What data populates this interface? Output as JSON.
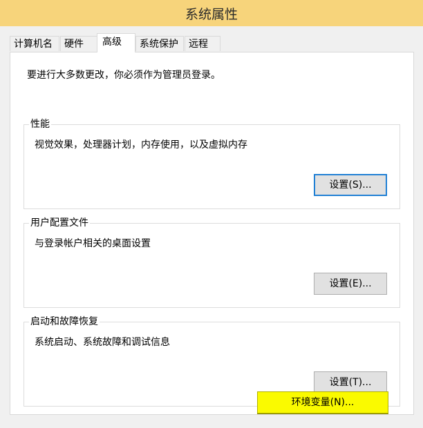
{
  "window": {
    "title": "系统属性"
  },
  "tabs": [
    {
      "label": "计算机名"
    },
    {
      "label": "硬件"
    },
    {
      "label": "高级"
    },
    {
      "label": "系统保护"
    },
    {
      "label": "远程"
    }
  ],
  "active_tab": "高级",
  "panel": {
    "notice": "要进行大多数更改，你必须作为管理员登录。",
    "groups": [
      {
        "title": "性能",
        "description": "视觉效果，处理器计划，内存使用，以及虚拟内存",
        "button": "设置(S)..."
      },
      {
        "title": "用户配置文件",
        "description": "与登录帐户相关的桌面设置",
        "button": "设置(E)..."
      },
      {
        "title": "启动和故障恢复",
        "description": "系统启动、系统故障和调试信息",
        "button": "设置(T)..."
      }
    ]
  },
  "env_button": {
    "label": "环境变量(N)...",
    "highlight_color": "#fafa00"
  },
  "colors": {
    "titlebar": "#f7d47b",
    "dialog_bg": "#f0f0f0",
    "panel_bg": "#ffffff",
    "focus_border": "#1f7fd4"
  }
}
